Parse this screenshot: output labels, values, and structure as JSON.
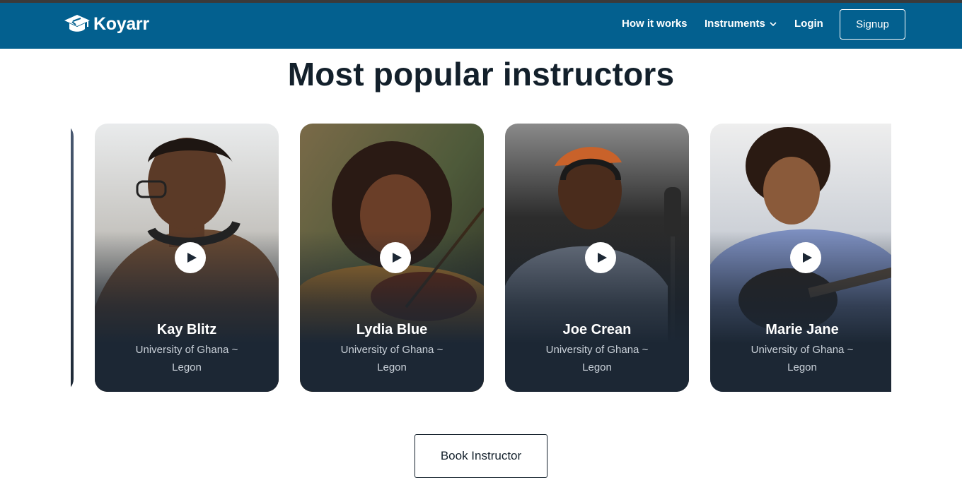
{
  "brand": {
    "name": "Koyarr",
    "nav_color": "#03608f",
    "dark_text": "#13202b"
  },
  "nav": {
    "how_it_works": "How it works",
    "instruments": "Instruments",
    "login": "Login",
    "signup": "Signup"
  },
  "main": {
    "heading": "Most popular instructors",
    "instructors": [
      {
        "name": "Kay Blitz",
        "school": "University of Ghana ~ Legon",
        "icon": "play-icon"
      },
      {
        "name": "Lydia Blue",
        "school": "University of Ghana ~ Legon",
        "icon": "play-icon"
      },
      {
        "name": "Joe Crean",
        "school": "University of Ghana ~ Legon",
        "icon": "play-icon"
      },
      {
        "name": "Marie Jane",
        "school": "University of Ghana ~ Legon",
        "icon": "play-icon"
      }
    ],
    "book_button": "Book Instructor"
  }
}
